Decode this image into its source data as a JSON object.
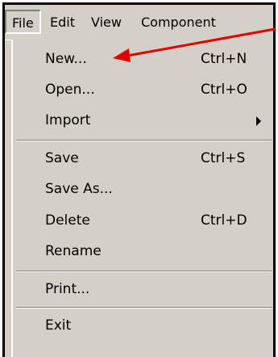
{
  "menubar": {
    "items": [
      {
        "label": "File"
      },
      {
        "label": "Edit"
      },
      {
        "label": "View"
      },
      {
        "label": "Component"
      }
    ]
  },
  "file_menu": {
    "items": [
      {
        "label": "New...",
        "shortcut": "Ctrl+N"
      },
      {
        "label": "Open...",
        "shortcut": "Ctrl+O"
      },
      {
        "label": "Import",
        "submenu": true
      },
      {
        "label": "Save",
        "shortcut": "Ctrl+S"
      },
      {
        "label": "Save As..."
      },
      {
        "label": "Delete",
        "shortcut": "Ctrl+D"
      },
      {
        "label": "Rename"
      },
      {
        "label": "Print..."
      },
      {
        "label": "Exit"
      }
    ]
  },
  "colors": {
    "menu_bg": "#d4d0c8",
    "annotation_arrow": "#e00000"
  }
}
